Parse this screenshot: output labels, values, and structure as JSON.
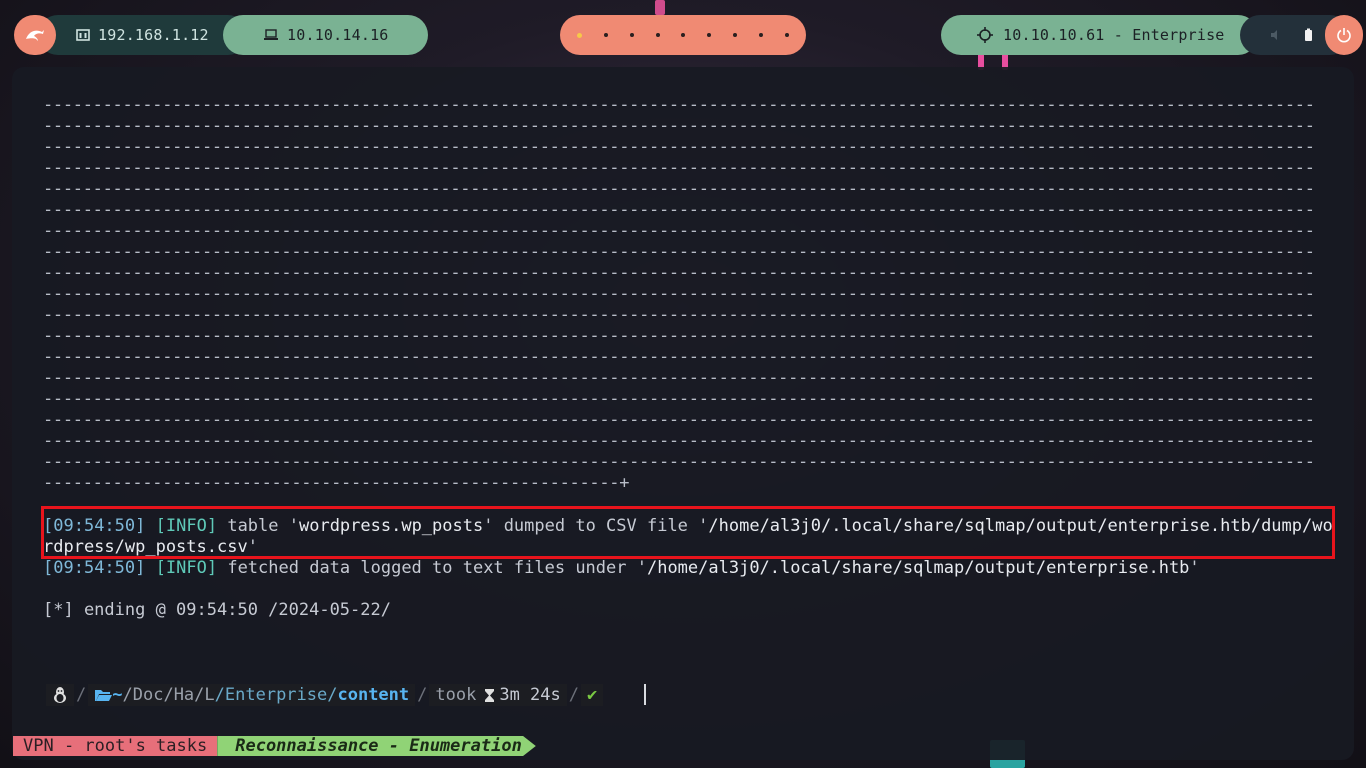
{
  "topbar": {
    "local_ip": "192.168.1.12",
    "vpn_ip": "10.10.14.16",
    "workspace_count": 9,
    "active_workspace": 1,
    "target": "10.10.10.61 - Enterprise"
  },
  "terminal": {
    "dash_line": "--------------------------------------------------------------------------------------------------------------------------------",
    "dash_tail": "----------------------------------------------------------+",
    "dash_line_count": 18,
    "lines": [
      {
        "time": "09:54:50",
        "level": "INFO",
        "text_a": " table '",
        "highlight_a": "wordpress.wp_posts",
        "text_b": "' dumped to CSV file '",
        "highlight_b": "/home/al3j0/.local/share/sqlmap/output/enterprise.htb/dump/wordpress/wp_posts.csv",
        "text_c": "'"
      },
      {
        "time": "09:54:50",
        "level": "INFO",
        "text_a": " fetched data logged to text files under '",
        "highlight_a": "/home/al3j0/.local/share/sqlmap/output/enterprise.htb",
        "text_b": "'"
      }
    ],
    "ending": "[*] ending @ 09:54:50 /2024-05-22/"
  },
  "prompt": {
    "path_home": "~",
    "path_doc": "/Doc",
    "path_ha": "/Ha",
    "path_l": "/L",
    "path_enterprise": "/Enterprise/",
    "path_content": "content",
    "took_label": "took",
    "duration": "3m 24s",
    "status": "✔"
  },
  "statusbar": {
    "session": "VPN - root's tasks",
    "task": "Reconnaissance - Enumeration"
  }
}
